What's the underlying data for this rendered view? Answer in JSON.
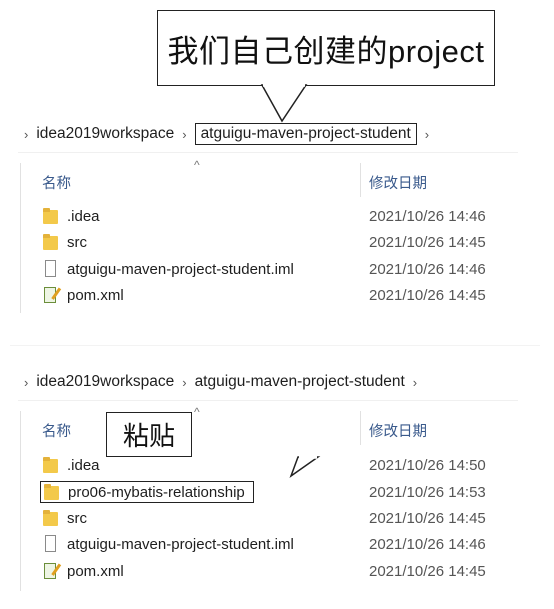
{
  "callout_top": "我们自己创建的project",
  "callout_paste": "粘贴",
  "panel1": {
    "breadcrumb": [
      "idea2019workspace",
      "atguigu-maven-project-student"
    ],
    "col_name": "名称",
    "col_date": "修改日期",
    "rows": [
      {
        "name": ".idea",
        "type": "folder",
        "date": "2021/10/26 14:46"
      },
      {
        "name": "src",
        "type": "folder",
        "date": "2021/10/26 14:45"
      },
      {
        "name": "atguigu-maven-project-student.iml",
        "type": "file",
        "date": "2021/10/26 14:46"
      },
      {
        "name": "pom.xml",
        "type": "xml",
        "date": "2021/10/26 14:45"
      }
    ]
  },
  "panel2": {
    "breadcrumb": [
      "idea2019workspace",
      "atguigu-maven-project-student"
    ],
    "col_name": "名称",
    "col_date": "修改日期",
    "rows": [
      {
        "name": ".idea",
        "type": "folder",
        "date": "2021/10/26 14:50"
      },
      {
        "name": "pro06-mybatis-relationship",
        "type": "folder",
        "date": "2021/10/26 14:53"
      },
      {
        "name": "src",
        "type": "folder",
        "date": "2021/10/26 14:45"
      },
      {
        "name": "atguigu-maven-project-student.iml",
        "type": "file",
        "date": "2021/10/26 14:46"
      },
      {
        "name": "pom.xml",
        "type": "xml",
        "date": "2021/10/26 14:45"
      }
    ]
  },
  "icons": {
    "breadcrumb_separator": "chevron-right-icon",
    "sort": "sort-ascending-icon",
    "folder": "folder-icon",
    "file": "file-icon",
    "xml": "xml-file-icon"
  },
  "colors": {
    "folder": "#f3c94a",
    "header_text": "#3a5a8c",
    "date_text": "#555555"
  }
}
